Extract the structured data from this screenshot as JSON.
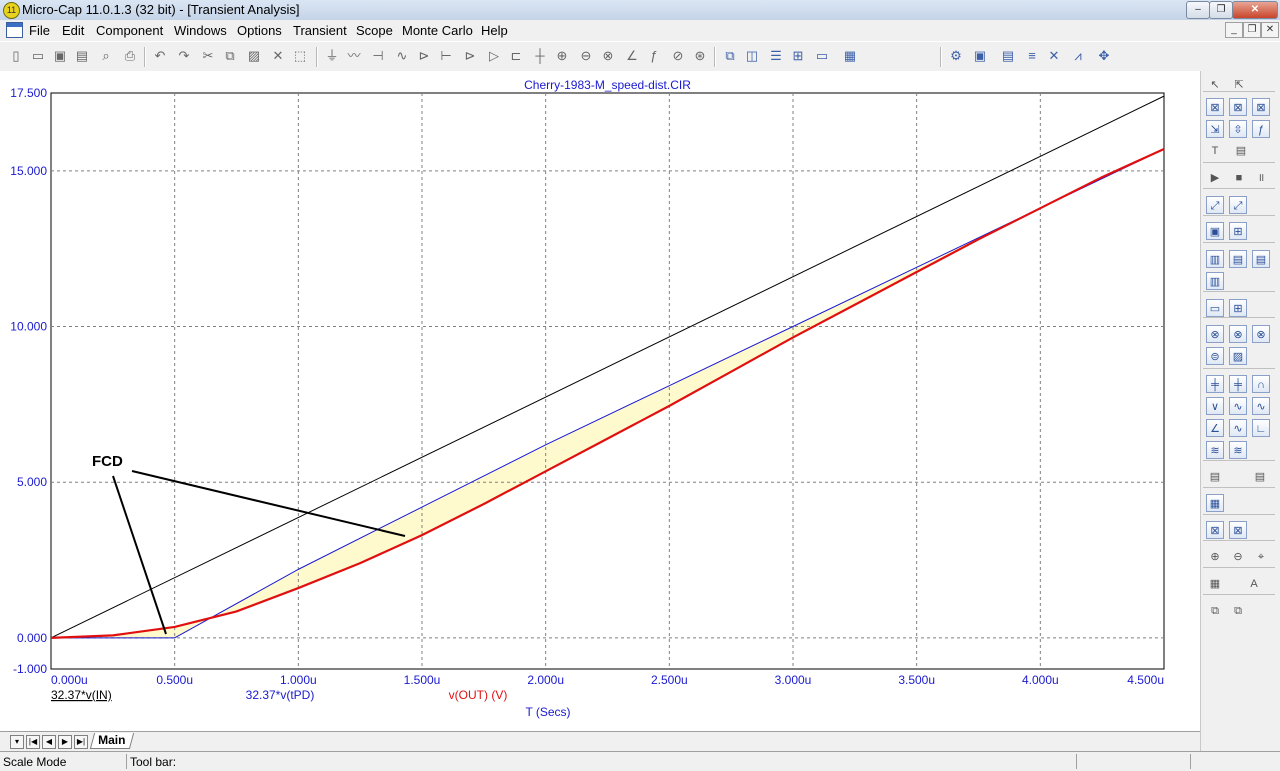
{
  "window": {
    "title": "Micro-Cap 11.0.1.3 (32 bit) - [Transient Analysis]",
    "app_icon_text": "11"
  },
  "menu": [
    "File",
    "Edit",
    "Component",
    "Windows",
    "Options",
    "Transient",
    "Scope",
    "Monte Carlo",
    "Help"
  ],
  "plot": {
    "title": "Cherry-1983-M_speed-dist.CIR",
    "annotation": "FCD",
    "y_ticks": [
      "17.500",
      "15.000",
      "10.000",
      "5.000",
      "0.000",
      "-1.000"
    ],
    "x_ticks": [
      "0.000u",
      "0.500u",
      "1.000u",
      "1.500u",
      "2.000u",
      "2.500u",
      "3.000u",
      "3.500u",
      "4.000u",
      "4.500u"
    ],
    "x_axis_label": "T (Secs)",
    "legend": [
      "32.37*v(IN)",
      "32.37*v(tPD)",
      "v(OUT) (V)"
    ]
  },
  "chart_data": {
    "type": "line",
    "title": "Cherry-1983-M_speed-dist.CIR",
    "xlabel": "T (Secs)",
    "ylabel": "",
    "xlim": [
      0,
      4.5
    ],
    "ylim": [
      -1,
      17.5
    ],
    "x_unit": "u",
    "grid": true,
    "series": [
      {
        "name": "32.37*v(IN)",
        "color": "#000000",
        "x": [
          0,
          4.5
        ],
        "y": [
          0,
          17.4
        ]
      },
      {
        "name": "32.37*v(tPD)",
        "color": "#1a1ad0",
        "x": [
          0,
          0.5,
          1.0,
          1.5,
          2.0,
          2.5,
          3.0,
          3.5,
          4.0,
          4.5
        ],
        "y": [
          0,
          0,
          2.2,
          4.2,
          6.2,
          8.1,
          10.0,
          11.9,
          13.8,
          15.7
        ]
      },
      {
        "name": "v(OUT) (V)",
        "color": "#e01010",
        "x": [
          0,
          0.25,
          0.5,
          0.75,
          1.0,
          1.25,
          1.5,
          1.75,
          2.0,
          2.25,
          2.5,
          2.75,
          3.0,
          3.25,
          3.5,
          3.75,
          4.0,
          4.25,
          4.5
        ],
        "y": [
          0,
          0.08,
          0.35,
          0.85,
          1.6,
          2.4,
          3.3,
          4.3,
          5.35,
          6.4,
          7.45,
          8.55,
          9.65,
          10.7,
          11.75,
          12.8,
          13.8,
          14.8,
          15.7
        ]
      }
    ]
  },
  "tabs": {
    "main": "Main"
  },
  "status": {
    "mode": "Scale Mode",
    "toolbar_label": "Tool bar:"
  },
  "colors": {
    "grid": "#808080",
    "axis_text": "#1a1ad0",
    "fill": "#fffacd",
    "title_text": "#1a1ad0",
    "out_text": "#e01010"
  }
}
